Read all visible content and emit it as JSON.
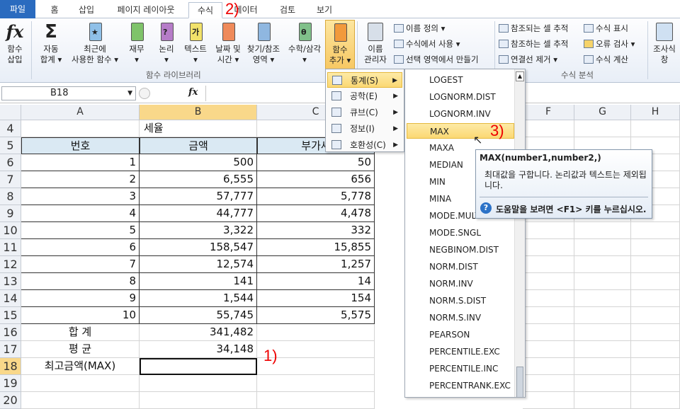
{
  "tabs": {
    "file": "파일",
    "home": "홈",
    "insert": "삽입",
    "page_layout": "페이지 레이아웃",
    "formulas": "수식",
    "data": "데이터",
    "review": "검토",
    "view": "보기"
  },
  "ribbon": {
    "insert_function": [
      "함수",
      "삽입"
    ],
    "autosum": [
      "자동",
      "합계 ▾"
    ],
    "recent": [
      "최근에",
      "사용한 함수 ▾"
    ],
    "financial": [
      "재무",
      "▾"
    ],
    "logical": [
      "논리",
      "▾"
    ],
    "text": [
      "텍스트",
      "▾"
    ],
    "datetime": [
      "날짜 및",
      "시간 ▾"
    ],
    "lookup": [
      "찾기/참조",
      "영역 ▾"
    ],
    "math": [
      "수학/삼각",
      "▾"
    ],
    "more": [
      "함수",
      "추가 ▾"
    ],
    "name_manager": [
      "이름",
      "관리자"
    ],
    "define_name": "이름 정의 ▾",
    "use_in_formula": "수식에서 사용 ▾",
    "create_from_selection": "선택 영역에서 만들기",
    "trace_precedents": "참조되는 셀 추적",
    "trace_dependents": "참조하는 셀 추적",
    "remove_arrows": "연결선 제거 ▾",
    "show_formulas": "수식 표시",
    "error_checking": "오류 검사 ▾",
    "evaluate": "수식 계산",
    "watch_window": [
      "조사식",
      "창"
    ],
    "group_function_library": "함수 라이브러리",
    "group_formula_auditing": "수식 분석",
    "book_letters": {
      "text": "가",
      "math": "θ",
      "logical": "?"
    }
  },
  "formula_bar": {
    "name_box": "B18",
    "fx": "fx"
  },
  "annotations": {
    "a1": "1)",
    "a2": "2)",
    "a3": "3)"
  },
  "grid": {
    "columns": [
      "A",
      "B",
      "C",
      "F",
      "G",
      "H"
    ],
    "rows": [
      "4",
      "5",
      "6",
      "7",
      "8",
      "9",
      "10",
      "11",
      "12",
      "13",
      "14",
      "15",
      "16",
      "17",
      "18",
      "19",
      "20"
    ],
    "title": "세율",
    "header": {
      "no": "번호",
      "amount": "금액",
      "tax": "부가세"
    },
    "data": [
      {
        "no": "1",
        "amount": "500",
        "tax": "50"
      },
      {
        "no": "2",
        "amount": "6,555",
        "tax": "656"
      },
      {
        "no": "3",
        "amount": "57,777",
        "tax": "5,778"
      },
      {
        "no": "4",
        "amount": "44,777",
        "tax": "4,478"
      },
      {
        "no": "5",
        "amount": "3,322",
        "tax": "332"
      },
      {
        "no": "6",
        "amount": "158,547",
        "tax": "15,855"
      },
      {
        "no": "7",
        "amount": "12,574",
        "tax": "1,257"
      },
      {
        "no": "8",
        "amount": "141",
        "tax": "14"
      },
      {
        "no": "9",
        "amount": "1,544",
        "tax": "154"
      },
      {
        "no": "10",
        "amount": "55,745",
        "tax": "5,575"
      }
    ],
    "sum_label": "합 계",
    "sum_value": "341,482",
    "avg_label": "평 균",
    "avg_value": "34,148",
    "max_label": "최고금액(MAX)"
  },
  "category_menu": [
    {
      "label": "통계(S)",
      "icon": "statistical-icon"
    },
    {
      "label": "공학(E)",
      "icon": "engineering-icon"
    },
    {
      "label": "큐브(C)",
      "icon": "cube-icon"
    },
    {
      "label": "정보(I)",
      "icon": "information-icon"
    },
    {
      "label": "호환성(C)",
      "icon": "compatibility-icon"
    }
  ],
  "function_list": [
    "LOGEST",
    "LOGNORM.DIST",
    "LOGNORM.INV",
    "MAX",
    "MAXA",
    "MEDIAN",
    "MIN",
    "MINA",
    "MODE.MULT",
    "MODE.SNGL",
    "NEGBINOM.DIST",
    "NORM.DIST",
    "NORM.INV",
    "NORM.S.DIST",
    "NORM.S.INV",
    "PEARSON",
    "PERCENTILE.EXC",
    "PERCENTILE.INC",
    "PERCENTRANK.EXC"
  ],
  "tooltip": {
    "title": "MAX(number1,number2,)",
    "description": "최대값을 구합니다. 논리값과 텍스트는 제외됩니다.",
    "help": "도움말을 보려면 <F1> 키를 누르십시오."
  },
  "colors": {
    "accent": "#2a6bbf",
    "highlight": "#fbd873",
    "annotation": "#ee0000",
    "header_fill": "#dae9f3"
  }
}
